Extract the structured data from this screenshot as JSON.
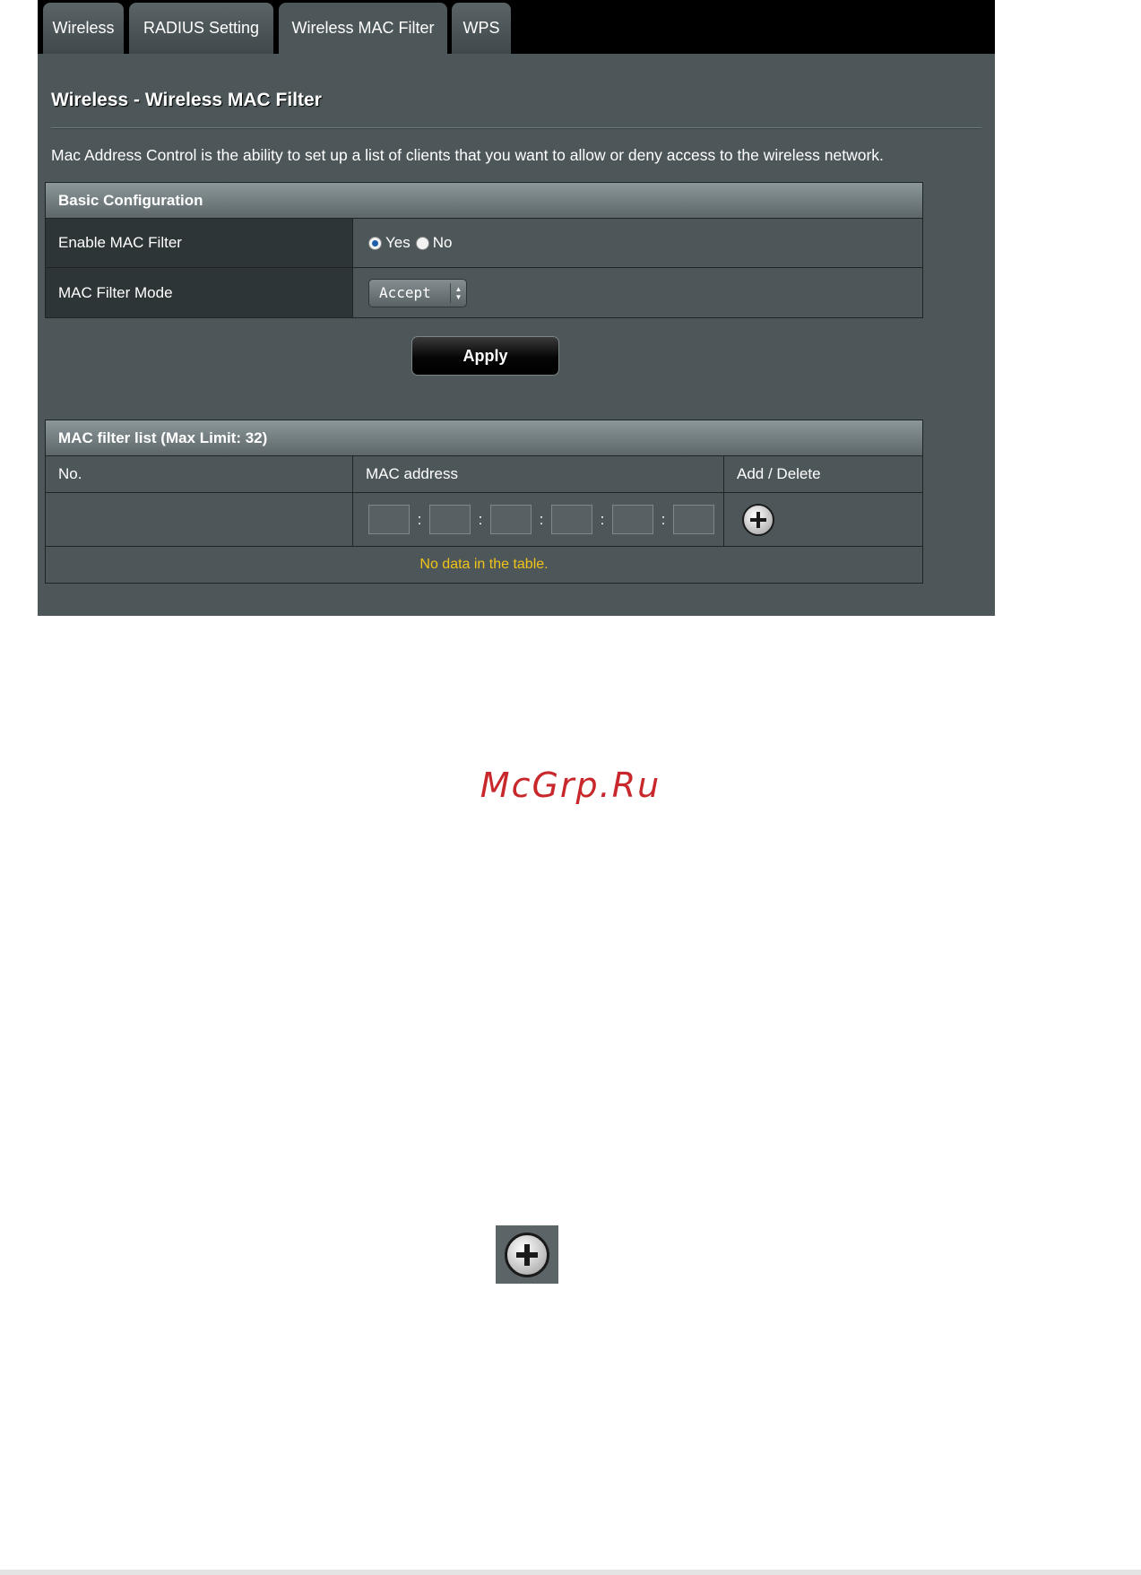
{
  "tabs": [
    {
      "label": "Wireless"
    },
    {
      "label": "RADIUS Setting"
    },
    {
      "label": "Wireless MAC Filter"
    },
    {
      "label": "WPS"
    }
  ],
  "page": {
    "title": "Wireless - Wireless MAC Filter",
    "description": "Mac Address Control is the ability to set up a list of clients that you want to allow or deny access to the wireless network."
  },
  "basic_config": {
    "header": "Basic Configuration",
    "enable_label": "Enable MAC Filter",
    "yes_label": "Yes",
    "no_label": "No",
    "enabled_value": "Yes",
    "mode_label": "MAC Filter Mode",
    "mode_value": "Accept"
  },
  "apply_label": "Apply",
  "filter_list": {
    "header": "MAC filter list (Max Limit: 32)",
    "col_no": "No.",
    "col_mac": "MAC address",
    "col_action": "Add / Delete",
    "separator": ":",
    "empty_message": "No data in the table."
  },
  "watermark": "McGrp.Ru",
  "icons": {
    "add": "add-circle-icon",
    "select_arrows": "updown-arrows-icon"
  },
  "colors": {
    "panel_bg": "#4d5759",
    "tab_bar_bg": "#000000",
    "empty_message": "#f2c318",
    "watermark": "#c8272c"
  }
}
